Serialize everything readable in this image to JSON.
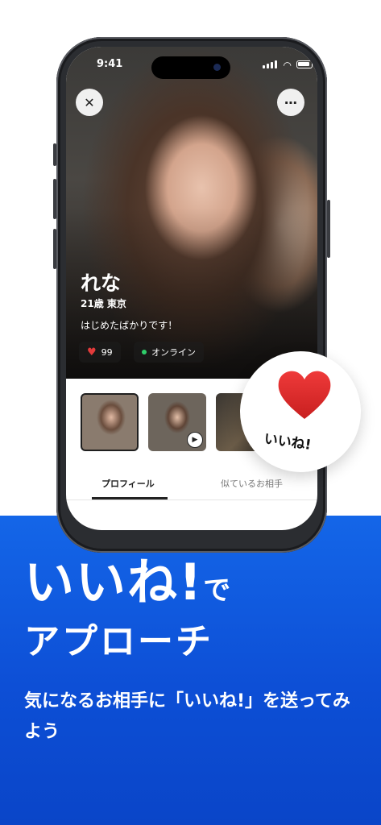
{
  "status_bar": {
    "time": "9:41"
  },
  "profile": {
    "name": "れな",
    "age_city": "21歳 東京",
    "intro": "はじめたばかりです！",
    "likes_count": "99",
    "online_status": "オンライン"
  },
  "tabs": [
    {
      "label": "プロフィール",
      "active": true
    },
    {
      "label": "似ているお相手",
      "active": false
    }
  ],
  "like_badge": {
    "label": "いいね!"
  },
  "headline": {
    "line1_main": "いいね!",
    "line1_suffix": "で",
    "line2": "アプローチ"
  },
  "subtext": "気になるお相手に「いいね!」を送ってみよう",
  "colors": {
    "accent_blue": "#1466e8",
    "heart_red": "#e33b3b",
    "online_green": "#2fce6a"
  },
  "icons": [
    "close-icon",
    "more-icon",
    "heart-icon",
    "online-dot-icon",
    "play-icon"
  ]
}
